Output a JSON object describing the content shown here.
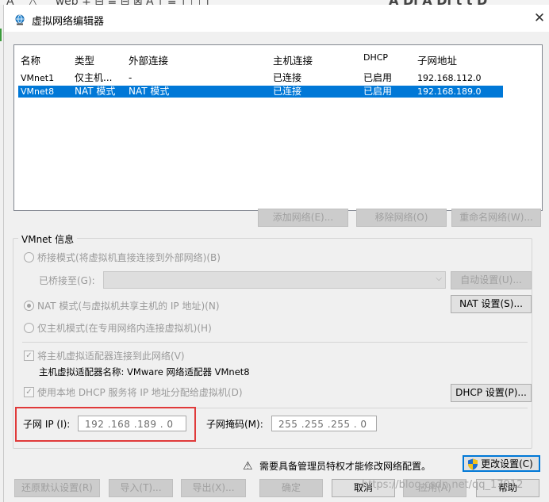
{
  "dialog": {
    "title": "虚拟网络编辑器",
    "close_glyph": "✕"
  },
  "network_list": {
    "headers": [
      "名称",
      "类型",
      "外部连接",
      "主机连接",
      "DHCP",
      "子网地址"
    ],
    "rows": [
      {
        "name": "VMnet1",
        "type": "仅主机...",
        "external": "-",
        "host": "已连接",
        "dhcp": "已启用",
        "subnet": "192.168.112.0",
        "selected": false
      },
      {
        "name": "VMnet8",
        "type": "NAT 模式",
        "external": "NAT 模式",
        "host": "已连接",
        "dhcp": "已启用",
        "subnet": "192.168.189.0",
        "selected": true
      }
    ],
    "selection_color": "#0078d7"
  },
  "list_buttons": {
    "add": "添加网络(E)...",
    "remove": "移除网络(O)",
    "rename": "重命名网络(W)..."
  },
  "vmnet_info": {
    "group_label": "VMnet 信息",
    "bridged_mode": "桥接模式(将虚拟机直接连接到外部网络)(B)",
    "bridged_to_label": "已桥接至(G):",
    "bridged_to_value": "",
    "auto_settings": "自动设置(U)...",
    "nat_mode": "NAT 模式(与虚拟机共享主机的 IP 地址)(N)",
    "nat_settings": "NAT 设置(S)...",
    "host_only_mode": "仅主机模式(在专用网络内连接虚拟机)(H)",
    "selected_mode": "nat",
    "connect_host_adapter": "将主机虚拟适配器连接到此网络(V)",
    "connect_host_adapter_checked": true,
    "adapter_name_text": "主机虚拟适配器名称: VMware 网络适配器 VMnet8",
    "use_local_dhcp": "使用本地 DHCP 服务将 IP 地址分配给虚拟机(D)",
    "use_local_dhcp_checked": true,
    "dhcp_settings": "DHCP 设置(P)...",
    "subnet_ip_label": "子网 IP (I):",
    "subnet_ip_value": "192 .168 .189 . 0",
    "subnet_mask_label": "子网掩码(M):",
    "subnet_mask_value": "255 .255 .255 . 0",
    "highlight_color": "#e03a3a"
  },
  "admin_notice": {
    "text": "需要具备管理员特权才能修改网络配置。",
    "change_settings": "更改设置(C)"
  },
  "footer_buttons": {
    "restore_defaults": "还原默认设置(R)",
    "import": "导入(T)...",
    "export": "导出(X)...",
    "ok": "确定",
    "cancel": "取消",
    "apply": "应用(A)",
    "help": "帮助"
  },
  "watermark": "https://blog.csdn.net/qq_17912"
}
